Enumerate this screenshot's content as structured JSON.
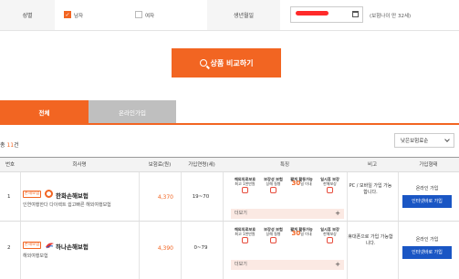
{
  "form": {
    "gender_label": "성별",
    "male_label": "남자",
    "female_label": "여자",
    "male_checked": true,
    "female_checked": false,
    "birth_label": "생년월일",
    "birth_value_redacted": true,
    "age_note": "(보험나이 만 32세)"
  },
  "compare_button": {
    "label": "상품 비교하기"
  },
  "tabs": [
    {
      "label": "전체",
      "active": true
    },
    {
      "label": "온라인가입",
      "active": false
    }
  ],
  "result": {
    "prefix": "총 ",
    "count": "11",
    "suffix": "건"
  },
  "sort": {
    "selected": "낮은보험료순"
  },
  "table": {
    "headers": [
      "번호",
      "회사명",
      "보험료(원)",
      "가입연령(세)",
      "특징",
      "비고",
      "가입형태"
    ],
    "rows": [
      {
        "no": "1",
        "badge": "손해보험",
        "company": "한화손해보험",
        "product": "인연여행한다 다이렉트 쉽고빠른 해외여행보험",
        "premium": "4,370",
        "age_range": "19~70",
        "features": [
          {
            "title": "해외의료보호",
            "sub": "최고 1천만원"
          },
          {
            "title": "보장성 보험",
            "sub": "상해 질병"
          },
          {
            "title": "짧게 활동가능",
            "num": "30",
            "unit": "일 이내"
          },
          {
            "title": "일시휴 보장",
            "sub": "한해보상"
          }
        ],
        "more": "더보기",
        "note": "PC / 모바일 가입 가능합니다.",
        "join_type": "온라인 가입",
        "join_button": "인터넷바로 가입"
      },
      {
        "no": "2",
        "badge": "손해보험",
        "company": "하나손해보험",
        "product": "해외여행보험",
        "premium": "4,390",
        "age_range": "0~79",
        "features": [
          {
            "title": "해외의료보호",
            "sub": "최고 1천만원"
          },
          {
            "title": "보장성 보험",
            "sub": "상해 질병"
          },
          {
            "title": "짧게 활동가능",
            "num": "30",
            "unit": "일 이내"
          },
          {
            "title": "일시휴 보장",
            "sub": "한해보상"
          }
        ],
        "more": "더보기",
        "note": "휴대폰으로 가입 가능합니다.",
        "join_type": "온라인 가입",
        "join_button": "인터넷바로 가입"
      }
    ]
  },
  "colors": {
    "accent": "#f26522",
    "join_button": "#1a56c4",
    "tab_inactive": "#bfbfbf"
  }
}
